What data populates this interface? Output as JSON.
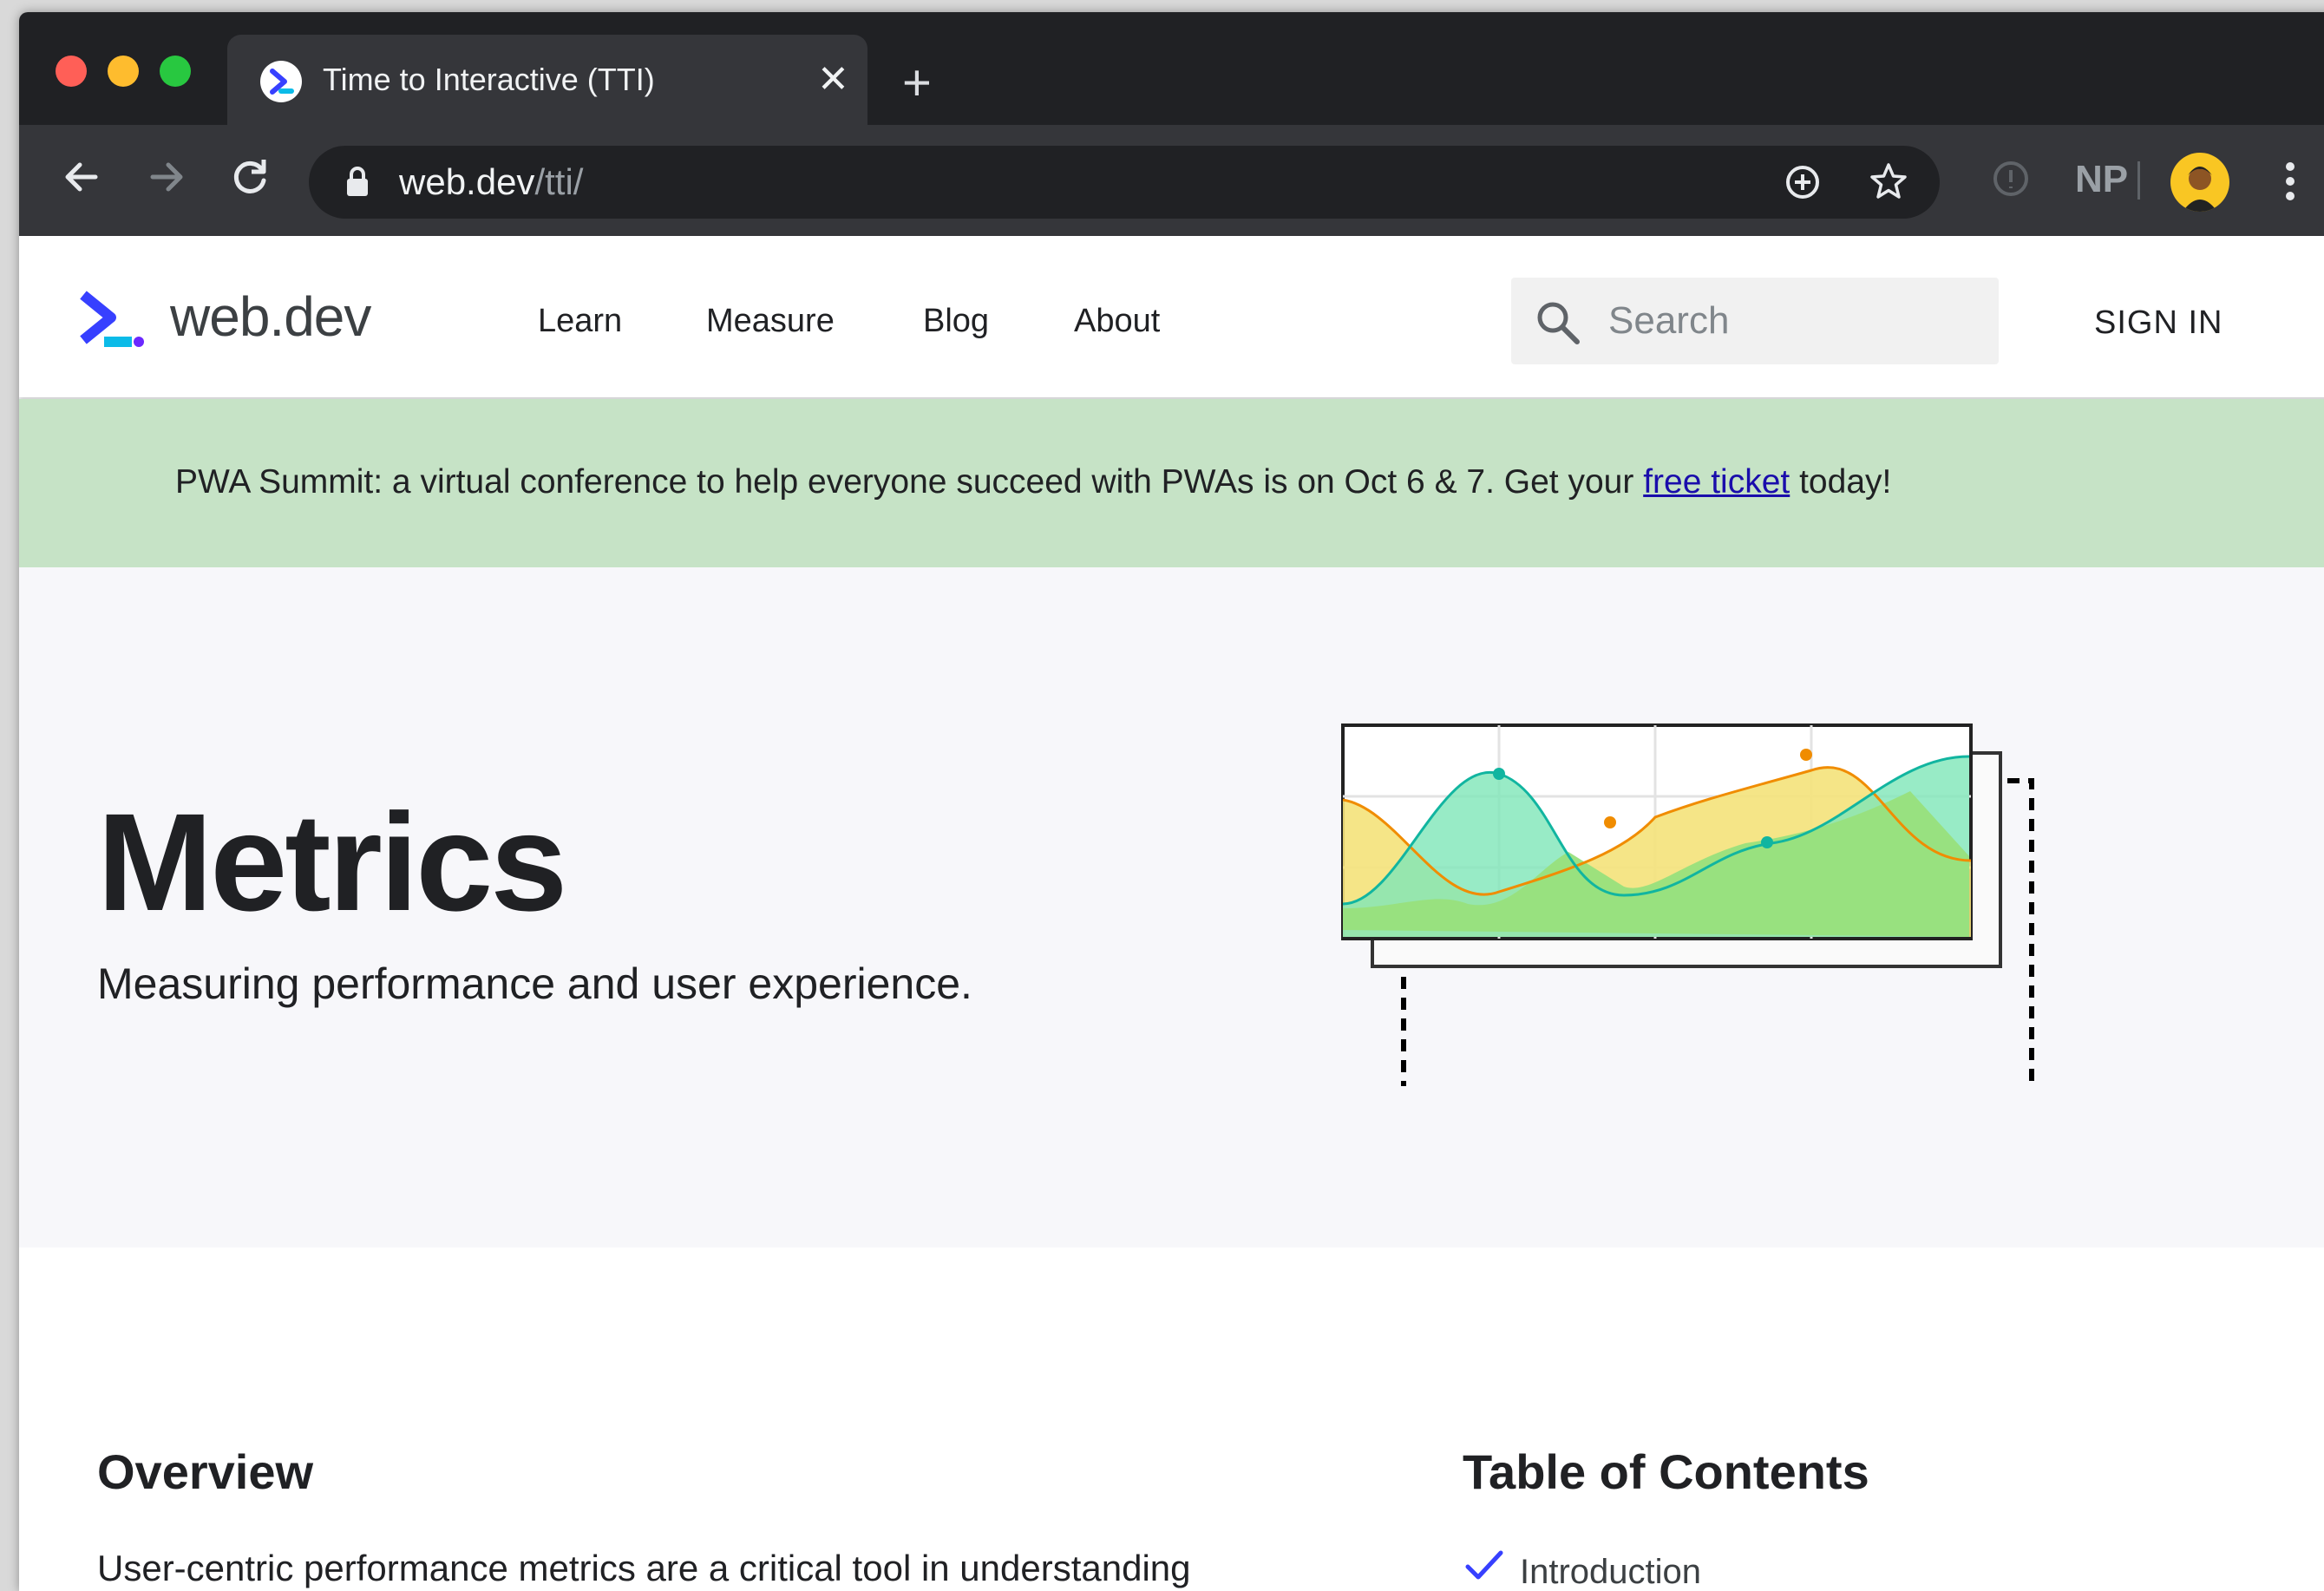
{
  "browser": {
    "tab_title": "Time to Interactive (TTI)",
    "tab_close": "✕",
    "new_tab": "+",
    "url_host": "web.dev",
    "url_path": "/tti/",
    "profile_initials": "NP"
  },
  "site": {
    "brand": "web.dev",
    "nav": [
      "Learn",
      "Measure",
      "Blog",
      "About"
    ],
    "search_placeholder": "Search",
    "sign_in": "SIGN IN"
  },
  "banner": {
    "text_before": "PWA Summit: a virtual conference to help everyone succeed with PWAs is on Oct 6 & 7. Get your ",
    "link": "free ticket",
    "text_after": " today!"
  },
  "hero": {
    "title": "Metrics",
    "subtitle": "Measuring performance and user experience."
  },
  "content": {
    "overview_heading": "Overview",
    "overview_text": "User-centric performance metrics are a critical tool in understanding",
    "toc_heading": "Table of Contents",
    "toc_items": [
      "Introduction"
    ]
  },
  "colors": {
    "traffic_red": "#ff5f57",
    "traffic_yellow": "#febc2e",
    "traffic_green": "#28c840",
    "banner_bg": "#c6e3c6",
    "link": "#1a0dab",
    "check": "#3740ff"
  }
}
